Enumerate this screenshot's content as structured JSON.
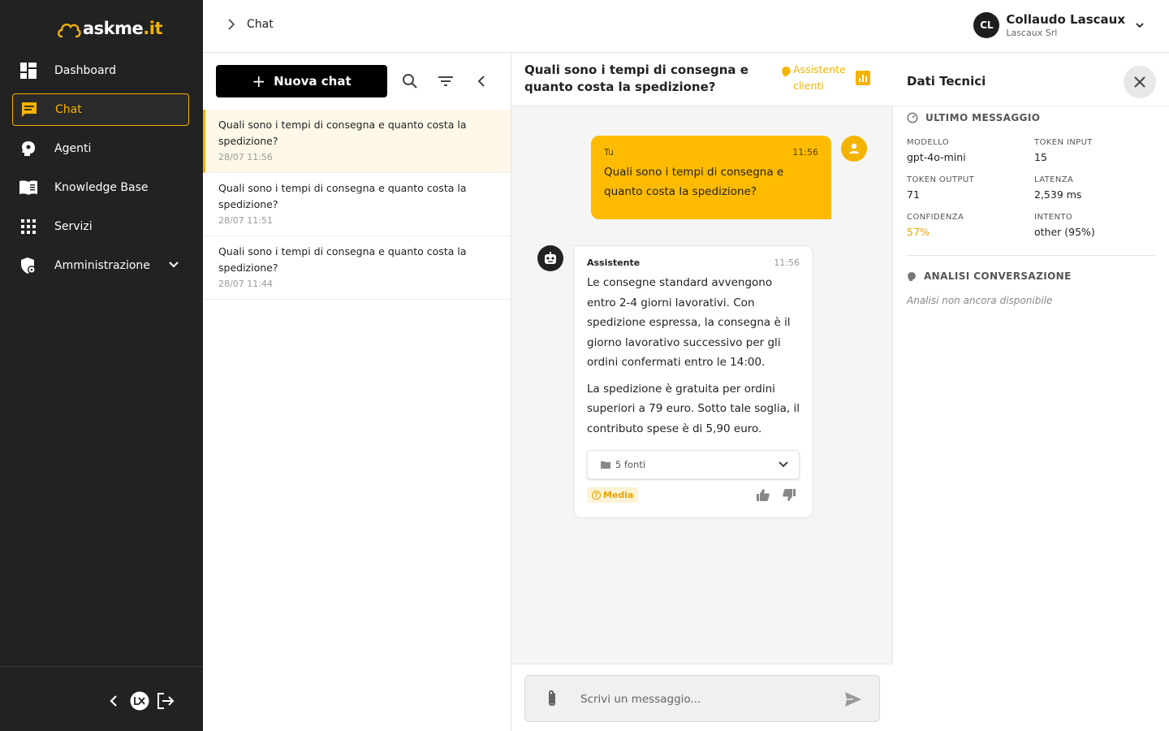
{
  "app": {
    "logo_text": "askme",
    "logo_suffix": ".it"
  },
  "sidebar": {
    "items": [
      {
        "label": "Dashboard",
        "icon": "dashboard-icon"
      },
      {
        "label": "Chat",
        "icon": "chat-icon",
        "active": true
      },
      {
        "label": "Agenti",
        "icon": "agent-head-icon"
      },
      {
        "label": "Knowledge Base",
        "icon": "book-icon"
      },
      {
        "label": "Servizi",
        "icon": "grid-icon"
      },
      {
        "label": "Amministrazione",
        "icon": "admin-shield-icon",
        "expandable": true
      }
    ],
    "bottom_icons": [
      "collapse-icon",
      "lx-badge-icon",
      "logout-icon"
    ]
  },
  "header": {
    "breadcrumb": "Chat",
    "user": {
      "initials": "CL",
      "name": "Collaudo Lascaux",
      "org": "Lascaux Srl"
    }
  },
  "chat_list": {
    "new_chat_label": "Nuova chat",
    "items": [
      {
        "title": "Quali sono i tempi di consegna e quanto costa la spedizione?",
        "date": "28/07 11:56"
      },
      {
        "title": "Quali sono i tempi di consegna e quanto costa la spedizione?",
        "date": "28/07 11:51"
      },
      {
        "title": "Quali sono i tempi di consegna e quanto costa la spedizione?",
        "date": "28/07 11:44"
      }
    ]
  },
  "conversation": {
    "title": "Quali sono i tempi di consegna e quanto costa la spedizione?",
    "agent_label": "Assistente clienti",
    "user_message": {
      "author": "Tu",
      "time": "11:56",
      "text": "Quali sono i tempi di consegna e quanto costa la spedizione?"
    },
    "bot_message": {
      "author": "Assistente",
      "time": "11:56",
      "paragraph1": "Le consegne standard avvengono entro 2-4 giorni lavorativi. Con spedizione espressa, la consegna è il giorno lavorativo successivo per gli ordini confermati entro le 14:00.",
      "paragraph2": "La spedizione è gratuita per ordini superiori a 79 euro. Sotto tale soglia, il contributo spese è di 5,90 euro.",
      "sources_label": "5 fonti",
      "confidence_label": "Media"
    },
    "composer": {
      "placeholder": "Scrivi un messaggio..."
    }
  },
  "tech_panel": {
    "title": "Dati Tecnici",
    "last_message_heading": "ULTIMO MESSAGGIO",
    "fields": {
      "model": {
        "key": "MODELLO",
        "value": "gpt-4o-mini"
      },
      "token_input": {
        "key": "TOKEN INPUT",
        "value": "15"
      },
      "token_output": {
        "key": "TOKEN OUTPUT",
        "value": "71"
      },
      "latency": {
        "key": "LATENZA",
        "value": "2,539 ms"
      },
      "confidence": {
        "key": "CONFIDENZA",
        "value": "57%"
      },
      "intent": {
        "key": "INTENTO",
        "value": "other (95%)"
      }
    },
    "analysis_heading": "ANALISI CONVERSAZIONE",
    "analysis_empty": "Analisi non ancora disponibile"
  },
  "colors": {
    "accent": "#f5b301",
    "sidebar_bg": "#222222",
    "user_bubble": "#ffbb00",
    "warning_text": "#e8a400"
  }
}
